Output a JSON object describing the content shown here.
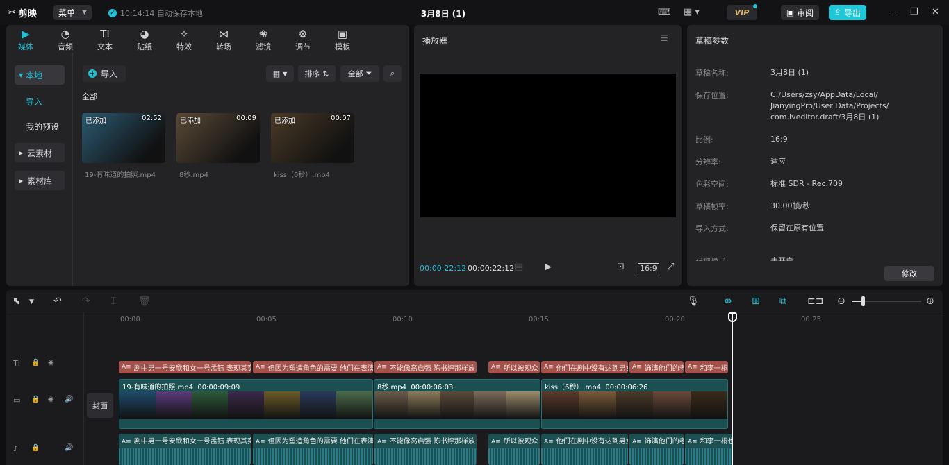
{
  "app": {
    "name": "剪映",
    "menu_label": "菜单",
    "autosave": "10:14:14 自动保存本地",
    "title": "3月8日 (1)",
    "vip": "VIP",
    "review": "审阅",
    "export": "导出"
  },
  "media_tabs": [
    {
      "label": "媒体",
      "icon": "media-icon",
      "active": true
    },
    {
      "label": "音频",
      "icon": "audio-icon"
    },
    {
      "label": "文本",
      "icon": "text-icon"
    },
    {
      "label": "贴纸",
      "icon": "sticker-icon"
    },
    {
      "label": "特效",
      "icon": "effects-icon"
    },
    {
      "label": "转场",
      "icon": "transition-icon"
    },
    {
      "label": "滤镜",
      "icon": "filter-icon"
    },
    {
      "label": "调节",
      "icon": "adjust-icon"
    },
    {
      "label": "模板",
      "icon": "template-icon"
    }
  ],
  "sidebar": {
    "local": "本地",
    "import": "导入",
    "presets": "我的预设",
    "cloud": "云素材",
    "library": "素材库"
  },
  "media_toolbar": {
    "import": "导入",
    "sort": "排序",
    "all_filter": "全部",
    "all_label": "全部"
  },
  "media_items": [
    {
      "badge": "已添加",
      "duration": "02:52",
      "name": "19-有味道的拍照.mp4",
      "color": "#2b5a72"
    },
    {
      "badge": "已添加",
      "duration": "00:09",
      "name": "8秒.mp4",
      "color": "#5a4a36"
    },
    {
      "badge": "已添加",
      "duration": "00:07",
      "name": "kiss（6秒）.mp4",
      "color": "#4a3a26"
    }
  ],
  "player": {
    "title": "播放器",
    "current_time": "00:00:22:12",
    "total_time": "00:00:22:12",
    "ratio": "16:9"
  },
  "draft": {
    "title": "草稿参数",
    "rows": [
      {
        "label": "草稿名称:",
        "value": "3月8日 (1)"
      },
      {
        "label": "保存位置:",
        "value": "C:/Users/zsy/AppData/Local/ JianyingPro/User Data/Projects/ com.lveditor.draft/3月8日 (1)"
      },
      {
        "label": "比例:",
        "value": "16:9"
      },
      {
        "label": "分辨率:",
        "value": "适应"
      },
      {
        "label": "色彩空间:",
        "value": "标准 SDR - Rec.709"
      },
      {
        "label": "草稿帧率:",
        "value": "30.00帧/秒"
      },
      {
        "label": "导入方式:",
        "value": "保留在原有位置"
      },
      {
        "label": "代理模式:",
        "value": "未开启"
      }
    ],
    "modify": "修改"
  },
  "timeline": {
    "ticks": [
      "00:00",
      "00:05",
      "00:10",
      "00:15",
      "00:20",
      "00:25"
    ],
    "cover": "封面",
    "captions": [
      "剧中男一号安欣和女一号孟钰 表现其实",
      "但因为塑造角色的需要 他们在表演",
      "不能像高启强 陈书婷那样放",
      "所以被观众",
      "他们在剧中没有达到男女",
      "饰演他们的老",
      "和李一桐"
    ],
    "video_clips": [
      {
        "name": "19-有味道的拍照.mp4",
        "duration": "00:00:09:09"
      },
      {
        "name": "8秒.mp4",
        "duration": "00:00:06:03"
      },
      {
        "name": "kiss（6秒）.mp4",
        "duration": "00:00:06:26"
      }
    ],
    "audio_clips": [
      "剧中男一号安欣和女一号孟钰 表现其实",
      "但因为塑造角色的需要 他们在表演",
      "不能像高启强 陈书婷那样放",
      "所以被观众",
      "他们在剧中没有达到男女",
      "饰演他们的老",
      "和李一桐也"
    ]
  }
}
